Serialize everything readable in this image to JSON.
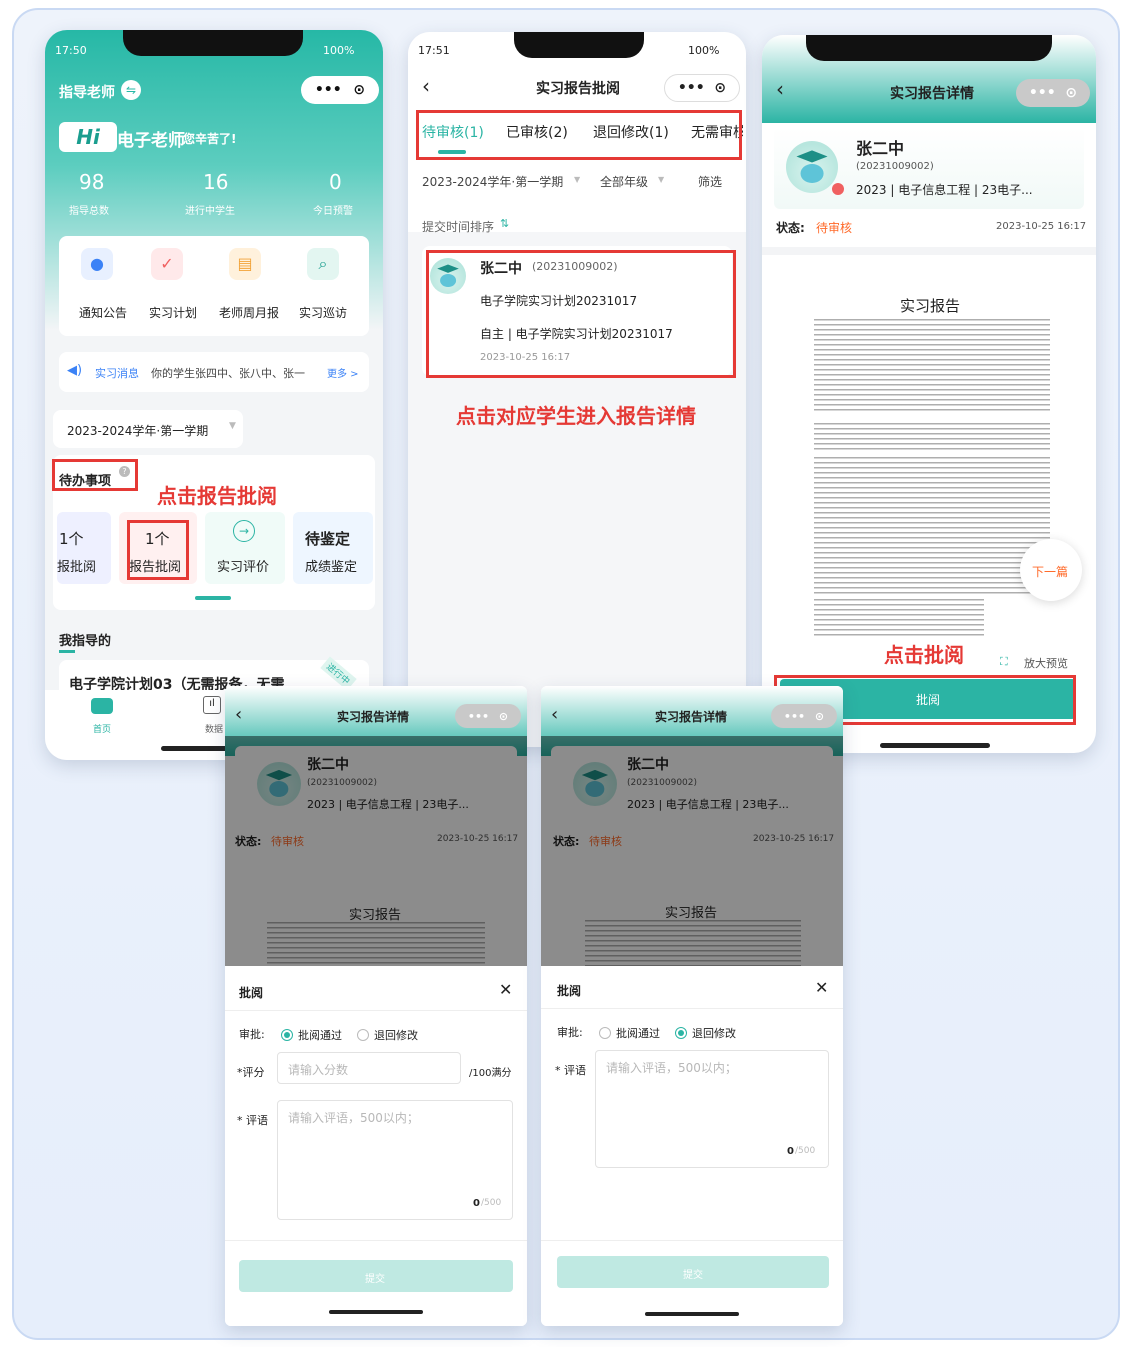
{
  "p1": {
    "time": "17:50",
    "battery": "100%",
    "role": "指导老师",
    "hi": "Hi",
    "greet": "电子老师",
    "greet_sub": "您辛苦了!",
    "stats": [
      {
        "value": "98",
        "label": "指导总数"
      },
      {
        "value": "16",
        "label": "进行中学生"
      },
      {
        "value": "0",
        "label": "今日预警"
      }
    ],
    "menu": [
      "通知公告",
      "实习计划",
      "老师周月报",
      "实习巡访"
    ],
    "news_tag": "实习消息",
    "news_text": "你的学生张四中、张八中、张一",
    "news_more": "更多 >",
    "term": "2023-2024学年·第一学期",
    "todo_title": "待办事项",
    "annot": "点击报告批阅",
    "todo": [
      {
        "num": "1个",
        "label": "报批阅"
      },
      {
        "num": "1个",
        "label": "报告批阅"
      },
      {
        "num": "",
        "label": "实习评价"
      },
      {
        "num": "待鉴定",
        "label": "成绩鉴定"
      }
    ],
    "guide_title": "我指导的",
    "plan": "电子学院计划03（无需报备，无需",
    "tag": "进行中",
    "nav": [
      "首页",
      "数据"
    ]
  },
  "p2": {
    "time": "17:51",
    "battery": "100%",
    "title": "实习报告批阅",
    "tabs": [
      "待审核(1)",
      "已审核(2)",
      "退回修改(1)",
      "无需审核"
    ],
    "filters": [
      "2023-2024学年·第一学期",
      "全部年级",
      "筛选"
    ],
    "sort": "提交时间排序",
    "card": {
      "name": "张二中",
      "id": "(20231009002)",
      "plan": "电子学院实习计划20231017",
      "type": "自主 | 电子学院实习计划20231017",
      "time": "2023-10-25 16:17"
    },
    "annot": "点击对应学生进入报告详情"
  },
  "p3": {
    "title": "实习报告详情",
    "name": "张二中",
    "id": "(20231009002)",
    "info": "2023 | 电子信息工程 | 23电子...",
    "status_label": "状态:",
    "status": "待审核",
    "time": "2023-10-25 16:17",
    "doc_title": "实习报告",
    "next": "下一篇",
    "zoom": "放大预览",
    "annot": "点击批阅",
    "button": "批阅"
  },
  "p4": {
    "title": "实习报告详情",
    "name": "张二中",
    "id": "(20231009002)",
    "info": "2023 | 电子信息工程 | 23电子...",
    "status_label": "状态:",
    "status": "待审核",
    "time": "2023-10-25 16:17",
    "doc_title": "实习报告",
    "sheet_title": "批阅",
    "approve_label": "审批:",
    "opt_pass": "批阅通过",
    "opt_return": "退回修改",
    "score_label": "*评分",
    "score_ph": "请输入分数",
    "score_suffix": "/100满分",
    "comment_label": "* 评语",
    "comment_ph": "请输入评语，500以内；",
    "count": "0",
    "count_max": "/500",
    "submit": "提交"
  },
  "p5": {
    "title": "实习报告详情",
    "name": "张二中",
    "id": "(20231009002)",
    "info": "2023 | 电子信息工程 | 23电子...",
    "status_label": "状态:",
    "status": "待审核",
    "time": "2023-10-25 16:17",
    "doc_title": "实习报告",
    "sheet_title": "批阅",
    "approve_label": "审批:",
    "opt_pass": "批阅通过",
    "opt_return": "退回修改",
    "comment_label": "* 评语",
    "comment_ph": "请输入评语，500以内；",
    "count": "0",
    "count_max": "/500",
    "submit": "提交"
  },
  "colors": {
    "teal": "#2bb4a4",
    "red": "#e53935",
    "orange": "#ff6a2a"
  }
}
